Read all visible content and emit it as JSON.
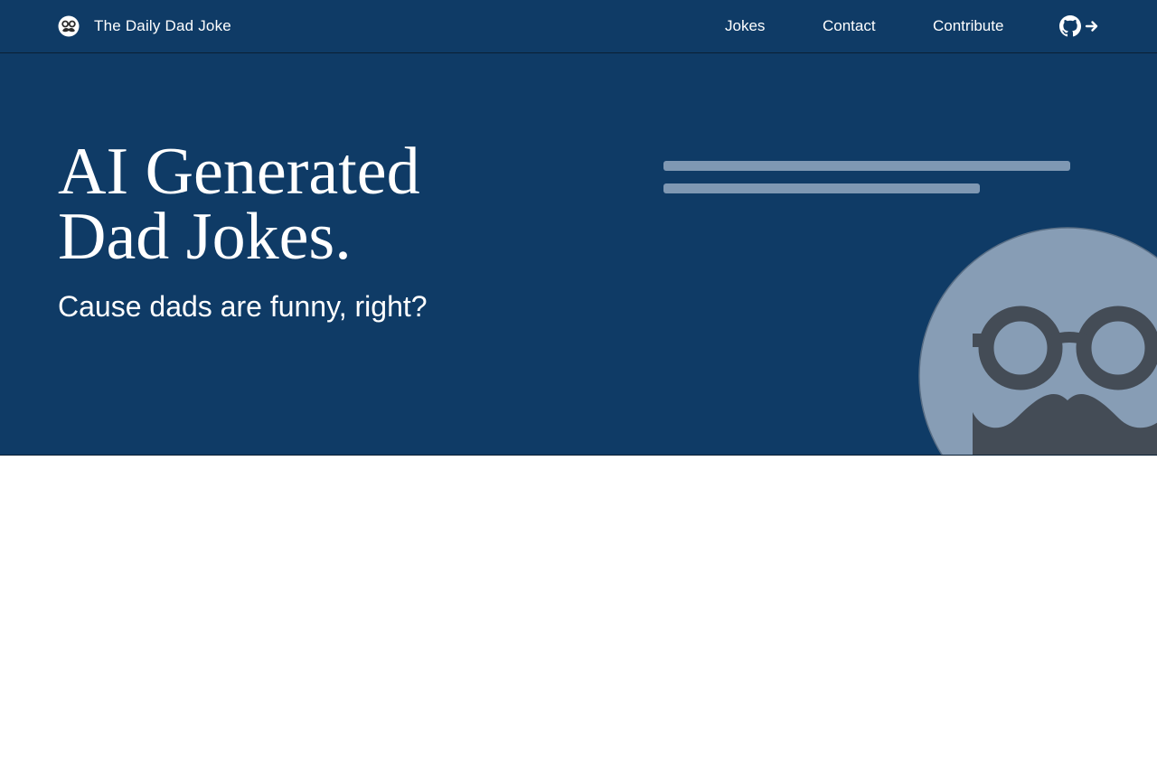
{
  "nav": {
    "brand_title": "The Daily Dad Joke",
    "links": [
      {
        "label": "Jokes"
      },
      {
        "label": "Contact"
      },
      {
        "label": "Contribute"
      }
    ],
    "github_icon": "github-icon",
    "arrow_icon": "arrow-right-icon"
  },
  "hero": {
    "title_line1": "AI Generated",
    "title_line2": "Dad Jokes.",
    "subtitle": "Cause dads are funny, right?",
    "mascot_icon": "dad-face-glasses-mustache-icon"
  },
  "colors": {
    "header_bg": "#0f3b66",
    "skeleton": "#7f98b3",
    "mascot_face": "#879db5",
    "mascot_features": "#444c56",
    "text": "#ffffff"
  }
}
